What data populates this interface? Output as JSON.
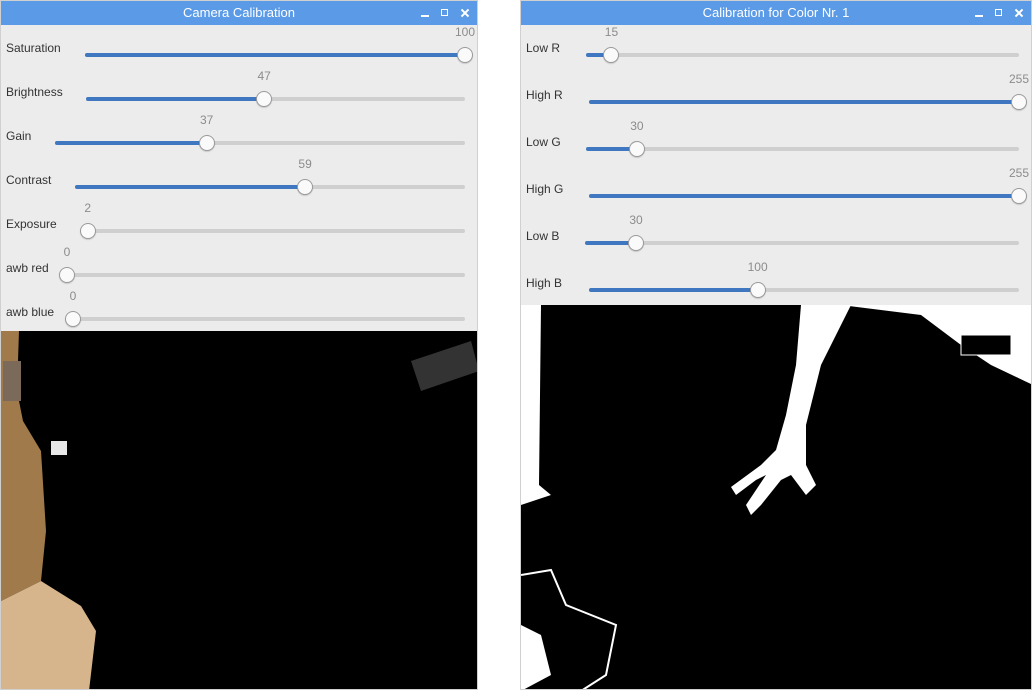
{
  "windows": [
    {
      "title": "Camera Calibration",
      "sliders": [
        {
          "label": "Saturation",
          "value": "100",
          "min": 0,
          "max": 100
        },
        {
          "label": "Brightness",
          "value": "47",
          "min": 0,
          "max": 100
        },
        {
          "label": "Gain",
          "value": "37",
          "min": 0,
          "max": 100
        },
        {
          "label": "Contrast",
          "value": "59",
          "min": 0,
          "max": 100
        },
        {
          "label": "Exposure",
          "value": "2",
          "min": 0,
          "max": 100
        },
        {
          "label": "awb red",
          "value": "0",
          "min": 0,
          "max": 100
        },
        {
          "label": "awb blue",
          "value": "0",
          "min": 0,
          "max": 100
        }
      ]
    },
    {
      "title": "Calibration for Color Nr. 1",
      "sliders": [
        {
          "label": "Low R",
          "value": "15",
          "min": 0,
          "max": 255
        },
        {
          "label": "High R",
          "value": "255",
          "min": 0,
          "max": 255
        },
        {
          "label": "Low G",
          "value": "30",
          "min": 0,
          "max": 255
        },
        {
          "label": "High G",
          "value": "255",
          "min": 0,
          "max": 255
        },
        {
          "label": "Low B",
          "value": "30",
          "min": 0,
          "max": 255
        },
        {
          "label": "High B",
          "value": "100",
          "min": 0,
          "max": 255
        }
      ]
    }
  ]
}
